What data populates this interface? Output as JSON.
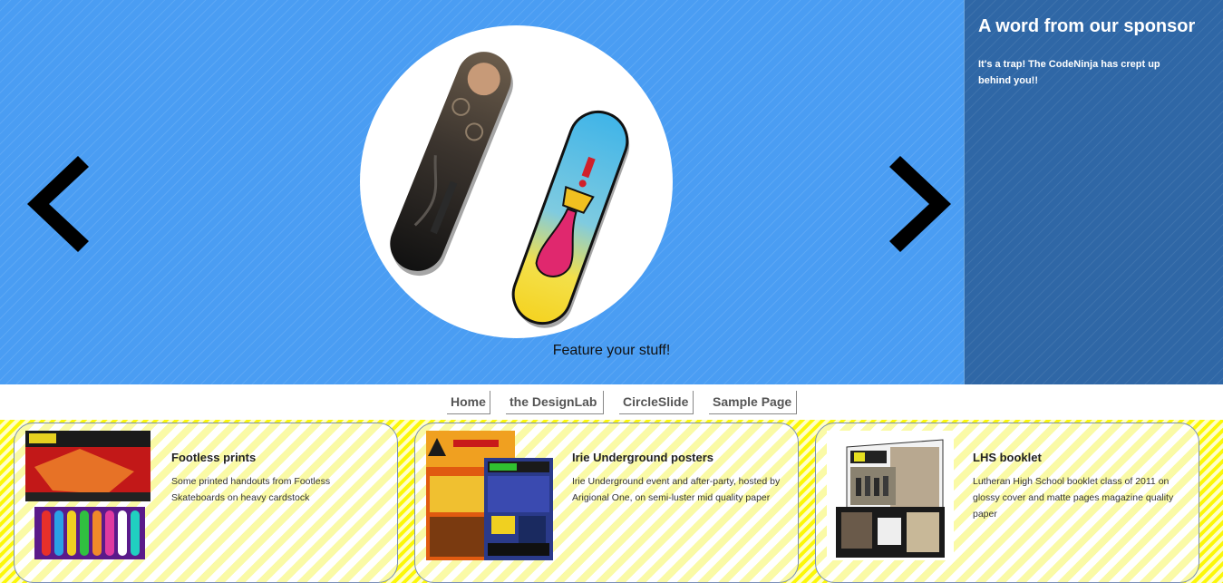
{
  "hero": {
    "caption": "Feature your stuff!",
    "prev_label": "previous",
    "next_label": "next",
    "accent_color": "#4a9df3"
  },
  "sidebar": {
    "title": "A word from our sponsor",
    "text": "It's a trap! The CodeNinja has crept up behind you!!",
    "bg_color": "#2f67a6"
  },
  "nav": {
    "items": [
      {
        "label": "Home"
      },
      {
        "label": "the DesignLab"
      },
      {
        "label": "CircleSlide"
      },
      {
        "label": "Sample Page"
      }
    ]
  },
  "cards": [
    {
      "title": "Footless prints",
      "text": "Some printed handouts from Footless Skateboards on heavy cardstock"
    },
    {
      "title": "Irie Underground posters",
      "text": "Irie Underground event and after-party, hosted by Arigional One, on semi-luster mid quality paper"
    },
    {
      "title": "LHS booklet",
      "text": "Lutheran High School booklet class of 2011 on glossy cover and matte pages magazine quality paper"
    }
  ]
}
